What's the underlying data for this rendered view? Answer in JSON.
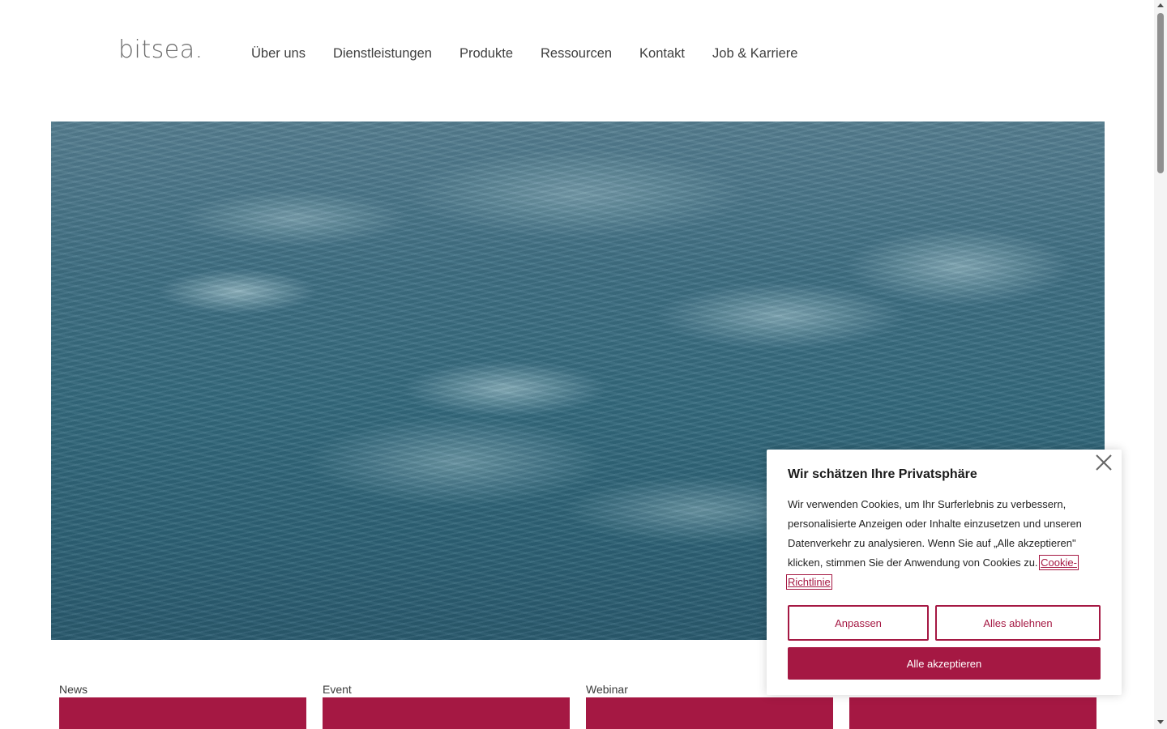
{
  "header": {
    "logo": "bitsea.",
    "nav": [
      "Über uns",
      "Dienstleistungen",
      "Produkte",
      "Ressourcen",
      "Kontakt",
      "Job & Karriere"
    ]
  },
  "hero": {
    "image": "ocean-waves-video"
  },
  "cards": [
    {
      "label": "News"
    },
    {
      "label": "Event"
    },
    {
      "label": "Webinar"
    },
    {
      "label": ""
    }
  ],
  "cookie": {
    "title": "Wir schätzen Ihre Privatsphäre",
    "body": "Wir verwenden Cookies, um Ihr Surferlebnis zu verbessern, personalisierte Anzeigen oder Inhalte einzusetzen und unseren Datenverkehr zu analysieren. Wenn Sie auf „Alle akzeptieren\" klicken, stimmen Sie der Anwendung von Cookies zu.",
    "policy_link": "Cookie-Richtlinie",
    "customize": "Anpassen",
    "reject": "Alles ablehnen",
    "accept": "Alle akzeptieren"
  },
  "colors": {
    "accent": "#a51843"
  },
  "icons": {
    "close": "close-icon"
  }
}
